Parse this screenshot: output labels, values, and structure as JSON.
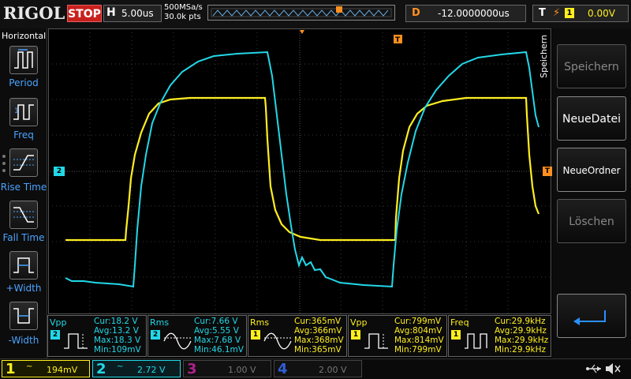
{
  "header": {
    "brand": "RIGOL",
    "run_state": "STOP",
    "timebase_label": "H",
    "timebase_value": "5.00us",
    "sample_rate": "500MSa/s",
    "memory_depth": "30.0k pts",
    "delay_label": "D",
    "delay_value": "-12.0000000us",
    "trigger_label": "T",
    "trigger_source": "1",
    "trigger_level": "0.00V"
  },
  "left_menu": {
    "title": "Horizontal",
    "items": [
      {
        "label": "Period",
        "icon": "period-icon"
      },
      {
        "label": "Freq",
        "icon": "frequency-icon"
      },
      {
        "label": "Rise Time",
        "icon": "rise-time-icon"
      },
      {
        "label": "Fall Time",
        "icon": "fall-time-icon"
      },
      {
        "label": "+Width",
        "icon": "positive-width-icon"
      },
      {
        "label": "-Width",
        "icon": "negative-width-icon"
      }
    ]
  },
  "right_menu": {
    "title": "Speichern",
    "keys": [
      {
        "label": "Speichern",
        "enabled": false
      },
      {
        "label": "NeueDatei",
        "enabled": true
      },
      {
        "label": "NeueOrdner",
        "enabled": true
      },
      {
        "label": "Löschen",
        "enabled": false
      }
    ],
    "back_icon": "return-arrow-icon"
  },
  "markers": {
    "ch2_offset": "2",
    "trigger_position": "T",
    "trigger_level_marker": "T"
  },
  "measurements": [
    {
      "name": "Vpp",
      "source": "2",
      "cur": "Cur:18.2 V",
      "avg": "Avg:13.2 V",
      "max": "Max:18.3 V",
      "min": "Min:109mV",
      "icon": "peak-to-peak-icon"
    },
    {
      "name": "Rms",
      "source": "2",
      "cur": "Cur:7.66 V",
      "avg": "Avg:5.55 V",
      "max": "Max:7.68 V",
      "min": "Min:46.1mV",
      "icon": "rms-icon"
    },
    {
      "name": "Rms",
      "source": "1",
      "cur": "Cur:365mV",
      "avg": "Avg:366mV",
      "max": "Max:368mV",
      "min": "Min:365mV",
      "icon": "rms-icon"
    },
    {
      "name": "Vpp",
      "source": "1",
      "cur": "Cur:799mV",
      "avg": "Avg:804mV",
      "max": "Max:814mV",
      "min": "Min:799mV",
      "icon": "peak-to-peak-icon"
    },
    {
      "name": "Freq",
      "source": "1",
      "cur": "Cur:29.9kHz",
      "avg": "Avg:29.9kHz",
      "max": "Max:29.9kHz",
      "min": "Min:29.9kHz",
      "icon": "frequency-icon"
    }
  ],
  "channels": [
    {
      "num": "1",
      "coupling": "~",
      "scale": "194mV",
      "color": "#ffef20",
      "active": true
    },
    {
      "num": "2",
      "coupling": "~",
      "scale": "2.72 V",
      "color": "#22d8e8",
      "active": true
    },
    {
      "num": "3",
      "coupling": "",
      "scale": "1.00 V",
      "color": "#b0208c",
      "active": false
    },
    {
      "num": "4",
      "coupling": "",
      "scale": "2.00 V",
      "color": "#3060d8",
      "active": false
    }
  ],
  "status_icons": [
    "usb-icon",
    "speaker-muted-icon"
  ],
  "colors": {
    "ch1": "#ffef20",
    "ch2": "#22d8e8",
    "accent": "#ff9020",
    "stop": "#c8201d",
    "measure_label": "#4aa3ff"
  }
}
